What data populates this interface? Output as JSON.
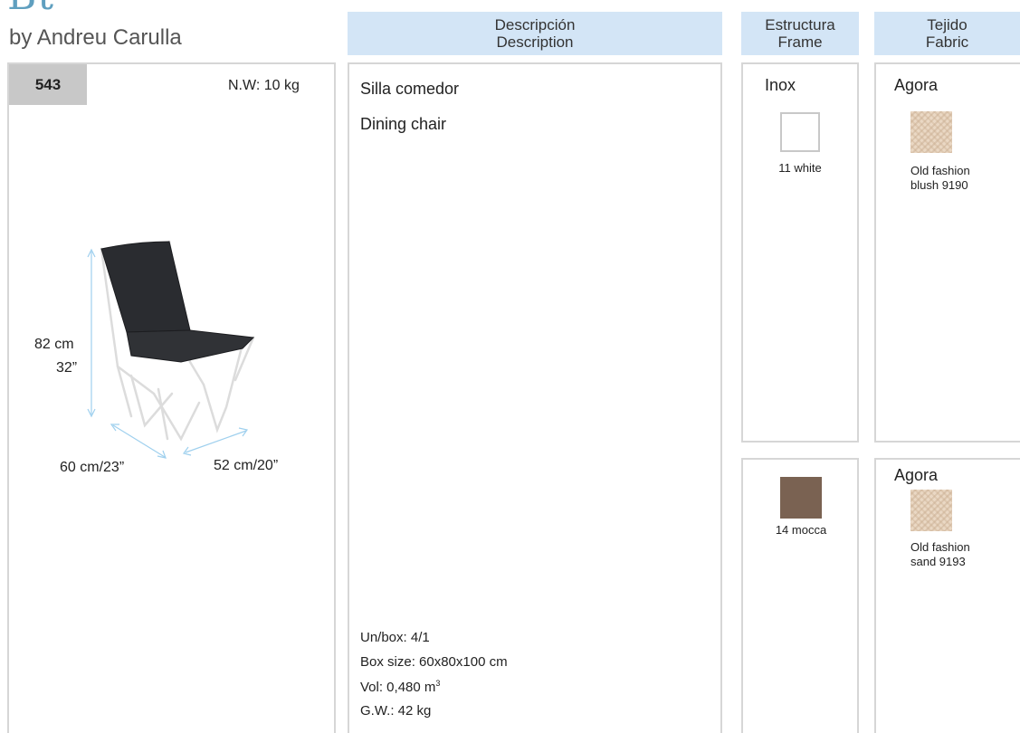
{
  "header": {
    "series_title": "Bt",
    "designer": "by Andreu Carulla",
    "col_description": {
      "es": "Descripción",
      "en": "Description"
    },
    "col_frame": {
      "es": "Estructura",
      "en": "Frame"
    },
    "col_fabric": {
      "es": "Tejido",
      "en": "Fabric"
    }
  },
  "product": {
    "code": "543",
    "net_weight": "N.W: 10 kg",
    "height_cm": "82 cm",
    "height_in": "32”",
    "width": "60 cm/23”",
    "depth": "52 cm/20”"
  },
  "description": {
    "name_es": "Silla comedor",
    "name_en": "Dining chair",
    "units_per_box": "Un/box: 4/1",
    "box_size": "Box size: 60x80x100 cm",
    "volume_prefix": "Vol: 0,480 m",
    "volume_sup": "3",
    "gross_weight": "G.W.: 42 kg"
  },
  "frames": [
    {
      "material": "Inox",
      "swatch_label": "11 white",
      "color": "#ffffff"
    },
    {
      "material": "",
      "swatch_label": "14 mocca",
      "color": "#7a6252"
    }
  ],
  "fabrics": [
    {
      "name": "Agora",
      "swatch_label_line1": "Old fashion",
      "swatch_label_line2": "blush 9190"
    },
    {
      "name": "Agora",
      "swatch_label_line1": "Old fashion",
      "swatch_label_line2": "sand 9193"
    }
  ],
  "colors": {
    "header_bg": "#d3e5f6",
    "code_bg": "#c8c8c8",
    "dimension_lines": "#9fd0ee",
    "border": "#d6d6d6"
  }
}
